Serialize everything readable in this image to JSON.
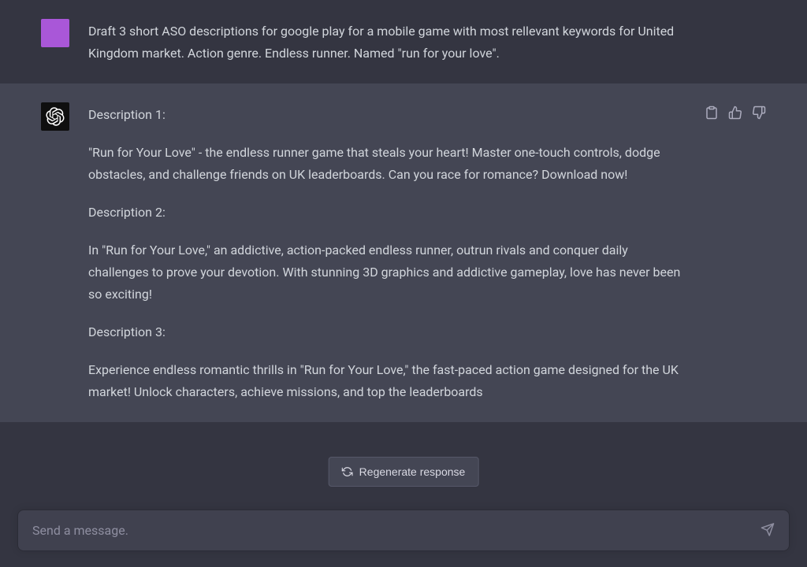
{
  "user_message": {
    "text": "Draft 3 short ASO descriptions for google play for a mobile game with most rellevant keywords for United Kingdom market. Action genre. Endless runner. Named \"run for your love\"."
  },
  "assistant_message": {
    "paragraphs": [
      "Description 1:",
      "\"Run for Your Love\" - the endless runner game that steals your heart! Master one-touch controls, dodge obstacles, and challenge friends on UK leaderboards. Can you race for romance? Download now!",
      "Description 2:",
      "In \"Run for Your Love,\" an addictive, action-packed endless runner, outrun rivals and conquer daily challenges to prove your devotion. With stunning 3D graphics and addictive gameplay, love has never been so exciting!",
      "Description 3:",
      "Experience endless romantic thrills in \"Run for Your Love,\" the fast-paced action game designed for the UK market! Unlock characters, achieve missions, and top the leaderboards"
    ]
  },
  "regenerate": {
    "label": "Regenerate response"
  },
  "input": {
    "placeholder": "Send a message."
  }
}
